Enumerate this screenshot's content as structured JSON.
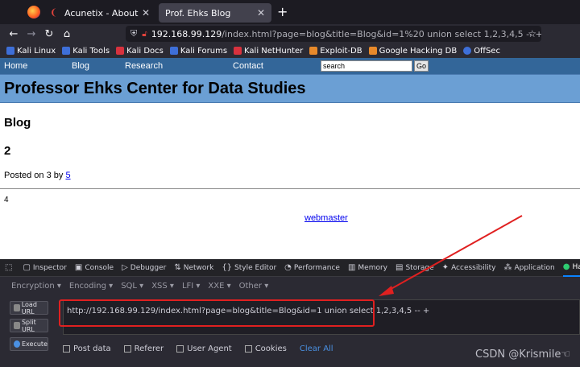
{
  "browser": {
    "tabs": [
      {
        "label": "Acunetix - About",
        "active": false
      },
      {
        "label": "Prof. Ehks Blog",
        "active": true
      }
    ],
    "url_host": "192.168.99.129",
    "url_path": "/index.html?page=blog&title=Blog&id=1%20 union select 1,2,3,4,5 -- +",
    "bookmarks": [
      "Kali Linux",
      "Kali Tools",
      "Kali Docs",
      "Kali Forums",
      "Kali NetHunter",
      "Exploit-DB",
      "Google Hacking DB",
      "OffSec"
    ]
  },
  "site": {
    "nav": {
      "home": "Home",
      "blog": "Blog",
      "research": "Research",
      "contact": "Contact",
      "search_value": "search",
      "go": "Go"
    },
    "banner": "Professor Ehks Center for Data Studies",
    "heading": "Blog",
    "post_title": "2",
    "posted_prefix": "Posted on 3 by ",
    "posted_author": "5",
    "body": "4",
    "footer_link": "webmaster"
  },
  "devtools": {
    "tabs": [
      "Inspector",
      "Console",
      "Debugger",
      "Network",
      "Style Editor",
      "Performance",
      "Memory",
      "Storage",
      "Accessibility",
      "Application",
      "HackBar"
    ],
    "active_tab": "HackBar",
    "menus": [
      "Encryption ▾",
      "Encoding ▾",
      "SQL ▾",
      "XSS ▾",
      "LFI ▾",
      "XXE ▾",
      "Other ▾"
    ],
    "buttons": {
      "load": "Load URL",
      "split": "Split URL",
      "execute": "Execute"
    },
    "url_value": "http://192.168.99.129/index.html?page=blog&title=Blog&id=1  union select 1,2,3,4,5 -- +",
    "options": [
      "Post data",
      "Referer",
      "User Agent",
      "Cookies"
    ],
    "clear_all": "Clear All"
  },
  "watermark": "CSDN @Krismile☜",
  "colors": {
    "accent_red": "#e02020",
    "site_nav": "#336699",
    "site_banner": "#6b9fd4"
  }
}
